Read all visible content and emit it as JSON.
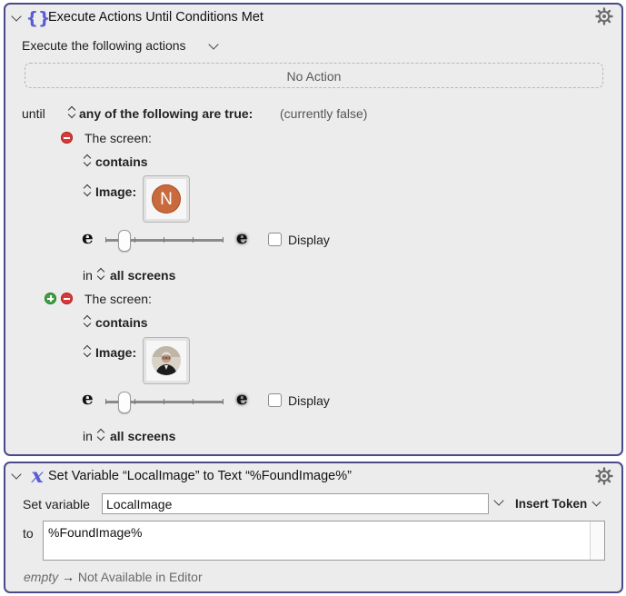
{
  "action1": {
    "title": "Execute Actions Until Conditions Met",
    "icon": "curly-braces-icon",
    "execute_label": "Execute the following actions",
    "no_action": "No Action",
    "until_label": "until",
    "condition_mode": "any of the following are true:",
    "condition_status": "(currently false)",
    "conditions": [
      {
        "label": "The screen:",
        "match": "contains",
        "image_label": "Image:",
        "image_letter": "N",
        "display_label": "Display",
        "in_label": "in",
        "screens": "all screens",
        "fuzz_low": "e",
        "fuzz_high": "e"
      },
      {
        "label": "The screen:",
        "match": "contains",
        "image_label": "Image:",
        "display_label": "Display",
        "in_label": "in",
        "screens": "all screens",
        "fuzz_low": "e",
        "fuzz_high": "e"
      }
    ]
  },
  "action2": {
    "title": "Set Variable “LocalImage” to Text “%FoundImage%”",
    "icon": "variable-x-icon",
    "set_variable_label": "Set variable",
    "variable_name": "LocalImage",
    "insert_token": "Insert Token",
    "to_label": "to",
    "text_value": "%FoundImage%",
    "preview_empty": "empty",
    "preview_arrow": "→",
    "preview_text": "Not Available in Editor"
  },
  "colors": {
    "panel_border": "#4a4a8a",
    "remove": "#d83a3a",
    "add": "#43a047",
    "n_avatar": "#c86a3c"
  }
}
